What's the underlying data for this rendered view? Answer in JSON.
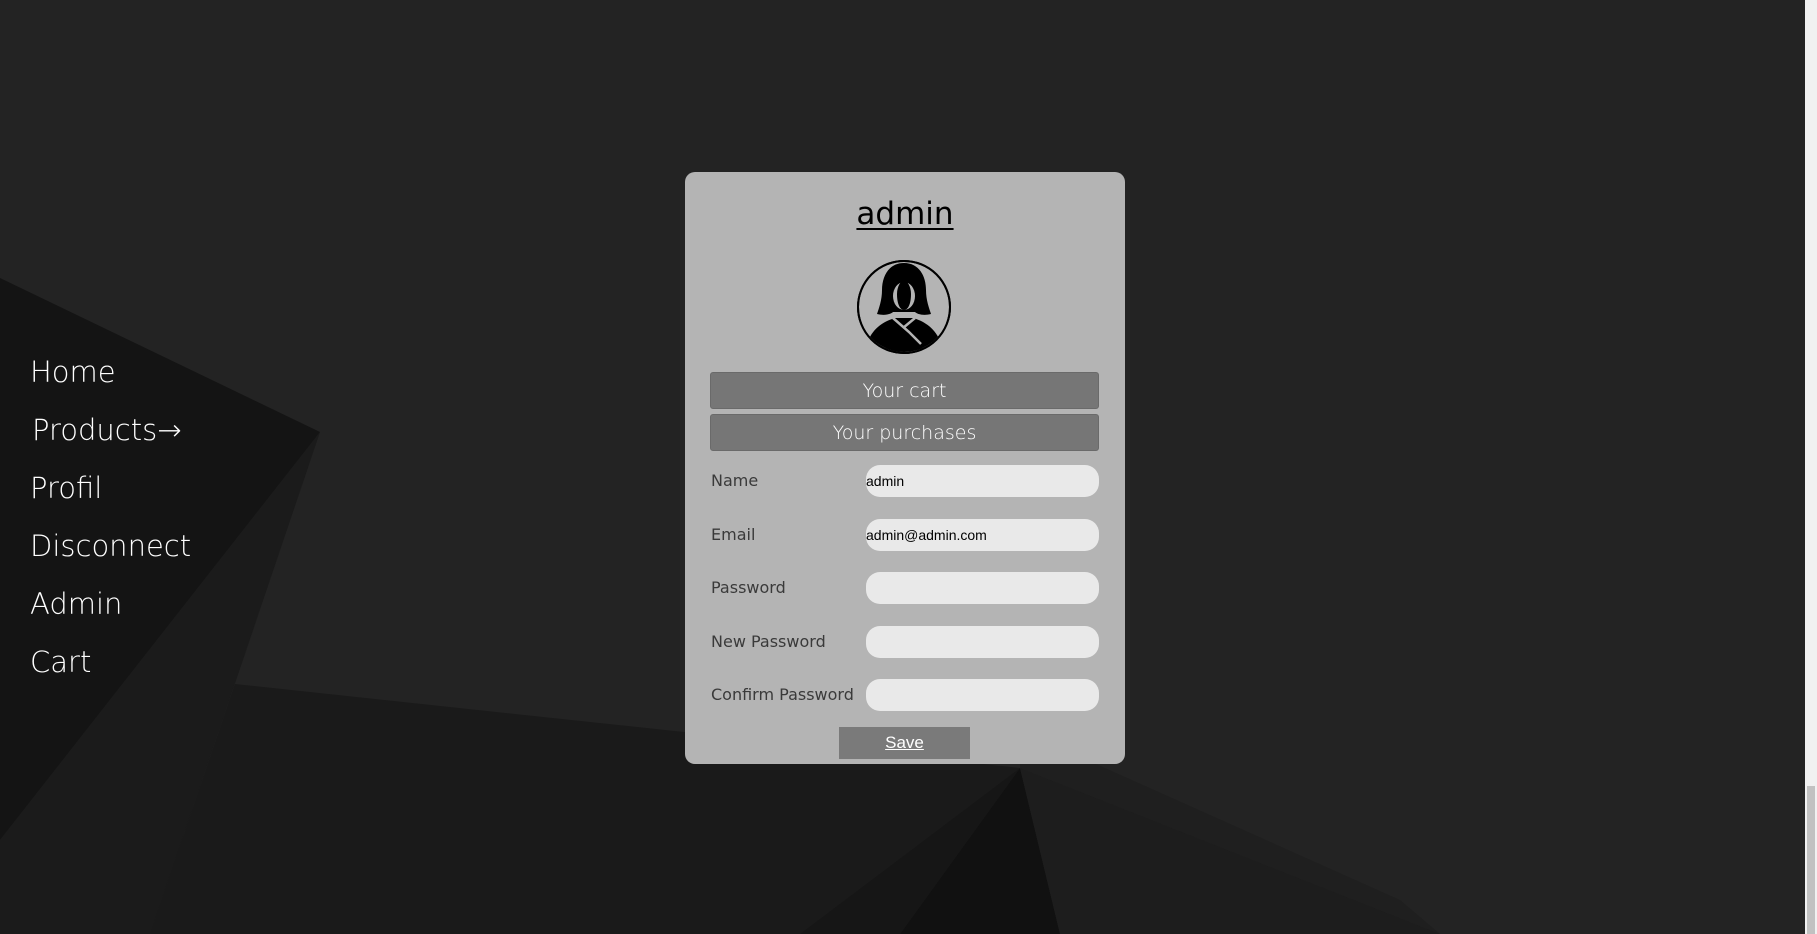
{
  "nav": {
    "items": [
      {
        "label": "Home"
      },
      {
        "label": "Products→"
      },
      {
        "label": "Profil"
      },
      {
        "label": "Disconnect"
      },
      {
        "label": "Admin"
      },
      {
        "label": "Cart"
      }
    ]
  },
  "profile": {
    "username": "admin",
    "avatar_icon": "user-avatar-icon",
    "cart_button": "Your cart",
    "purchases_button": "Your purchases",
    "fields": [
      {
        "label": "Name",
        "value": "admin"
      },
      {
        "label": "Email",
        "value": "admin@admin.com"
      },
      {
        "label": "Password",
        "value": ""
      },
      {
        "label": "New Password",
        "value": ""
      },
      {
        "label": "Confirm Password",
        "value": ""
      }
    ],
    "save_label": "Save"
  },
  "colors": {
    "background": "#232323",
    "panel": "#b4b4b4",
    "button": "#767676",
    "input": "#e9e9e9"
  }
}
